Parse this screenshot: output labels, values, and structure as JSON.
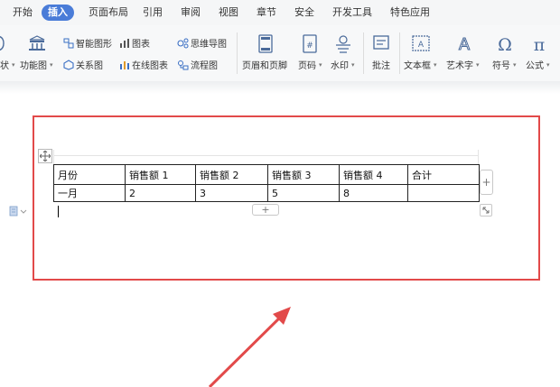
{
  "menu": {
    "tabs": [
      {
        "label": "开始"
      },
      {
        "label": "插入"
      },
      {
        "label": "页面布局"
      },
      {
        "label": "引用"
      },
      {
        "label": "审阅"
      },
      {
        "label": "视图"
      },
      {
        "label": "章节"
      },
      {
        "label": "安全"
      },
      {
        "label": "开发工具"
      },
      {
        "label": "特色应用"
      }
    ],
    "active": "插入"
  },
  "ribbon": {
    "cut_left_label": "状",
    "funcmap_label": "功能图",
    "smart_shape": "智能图形",
    "chart": "图表",
    "mindmap": "思维导图",
    "relation": "关系图",
    "online_chart": "在线图表",
    "flowchart": "流程图",
    "header_footer": "页眉和页脚",
    "page_number": "页码",
    "watermark": "水印",
    "comment": "批注",
    "textbox": "文本框",
    "wordart": "艺术字",
    "symbol": "符号",
    "formula": "公式"
  },
  "table": {
    "headers": [
      "月份",
      "销售额 1",
      "销售额 2",
      "销售额 3",
      "销售额 4",
      "合计"
    ],
    "rows": [
      [
        "一月",
        "2",
        "3",
        "5",
        "8",
        ""
      ]
    ]
  },
  "controls": {
    "add_column": "+",
    "add_row": "+"
  },
  "colors": {
    "accent": "#4a7cd8",
    "highlight": "#e24a4a"
  }
}
